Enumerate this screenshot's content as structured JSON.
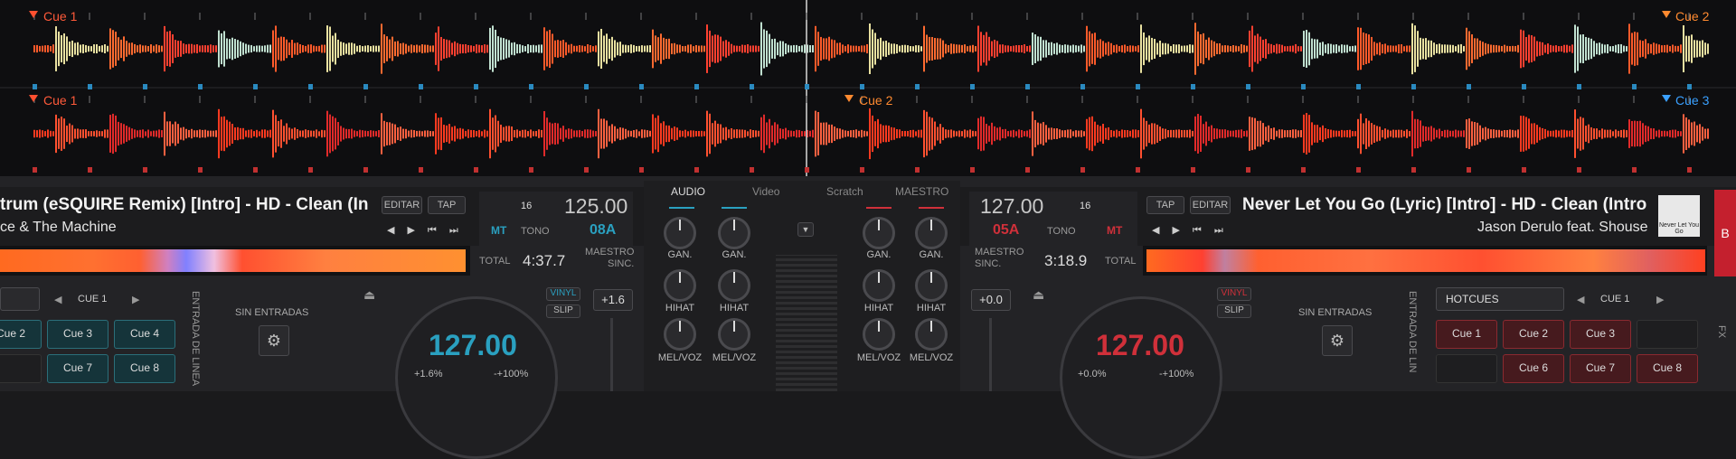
{
  "waveform": {
    "cues_top": [
      {
        "label": "Cue 1",
        "color": "#ff5030"
      },
      {
        "label": "Cue 2",
        "color": "#ff8a30"
      }
    ],
    "cues_bottom": [
      {
        "label": "Cue 1",
        "color": "#ff5030"
      },
      {
        "label": "Cue 2",
        "color": "#ff8a30"
      },
      {
        "label": "Cue 3",
        "color": "#3aa0ff"
      }
    ]
  },
  "deck_left": {
    "title": "trum (eSQUIRE Remix) [Intro] - HD - Clean (In",
    "artist": "ce & The Machine",
    "edit_label": "EDITAR",
    "tap_label": "TAP",
    "beats": "16",
    "bpm": "125.00",
    "mt": "MT",
    "tono": "TONO",
    "key": "08A",
    "total_label": "TOTAL",
    "total_time": "4:37.7",
    "maestro": "MAESTRO",
    "sinc": "SINC.",
    "cue_nav": "CUE 1",
    "sin_entradas": "SIN ENTRADAS",
    "entrada": "ENTRADA DE LINEA",
    "vinyl": "VINYL",
    "slip": "SLIP",
    "pitch": "+1.6",
    "platter_bpm": "127.00",
    "pitch_pct": "+1.6%",
    "range": "-+100%",
    "cues": [
      "Cue 2",
      "Cue 3",
      "Cue 4",
      "",
      "Cue 7",
      "Cue 8"
    ]
  },
  "mixer": {
    "tabs": [
      "AUDIO",
      "Video",
      "Scratch",
      "MAESTRO"
    ],
    "gain": "GAN.",
    "hihat": "HIHAT",
    "melvoz": "MEL/VOZ"
  },
  "deck_right": {
    "title": "Never Let You Go (Lyric) [Intro] - HD - Clean (Intro",
    "artist": "Jason Derulo feat. Shouse",
    "edit_label": "EDITAR",
    "tap_label": "TAP",
    "beats": "16",
    "bpm": "127.00",
    "mt": "MT",
    "tono": "TONO",
    "key": "05A",
    "total_label": "TOTAL",
    "total_time": "3:18.9",
    "maestro": "MAESTRO",
    "sinc": "SINC.",
    "hotcues": "HOTCUES",
    "cue_nav": "CUE 1",
    "sin_entradas": "SIN ENTRADAS",
    "entrada": "ENTRADA DE LIN",
    "vinyl": "VINYL",
    "slip": "SLIP",
    "pitch": "+0.0",
    "platter_bpm": "127.00",
    "pitch_pct": "+0.0%",
    "range": "-+100%",
    "cues": [
      "Cue 1",
      "Cue 2",
      "Cue 3",
      "",
      "Cue 6",
      "Cue 7",
      "Cue 8"
    ],
    "art_text": "Never Let You Go"
  },
  "side": {
    "b": "B",
    "fx": "FX"
  },
  "colors": {
    "teal": "#2aa0c0",
    "red": "#d0303a",
    "accent_red": "#c4202e"
  }
}
